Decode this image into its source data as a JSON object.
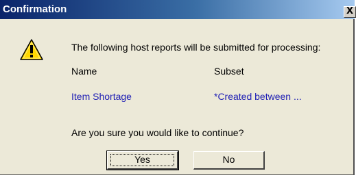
{
  "dialog": {
    "title": "Confirmation",
    "close_glyph": "X",
    "icon": "warning-icon",
    "message": "The following host reports will be submitted for processing:",
    "columns": {
      "name_header": "Name",
      "subset_header": "Subset"
    },
    "rows": [
      {
        "name": "Item Shortage",
        "subset": "*Created between ..."
      }
    ],
    "question": "Are you sure you would like to continue?",
    "buttons": {
      "yes_label": "Yes",
      "no_label": "No"
    }
  },
  "colors": {
    "title_bar_start": "#0a246a",
    "title_bar_end": "#a6caf0",
    "link_text": "#1e1eb4",
    "dialog_background": "#ece9d8",
    "warning_fill": "#ffd800"
  }
}
